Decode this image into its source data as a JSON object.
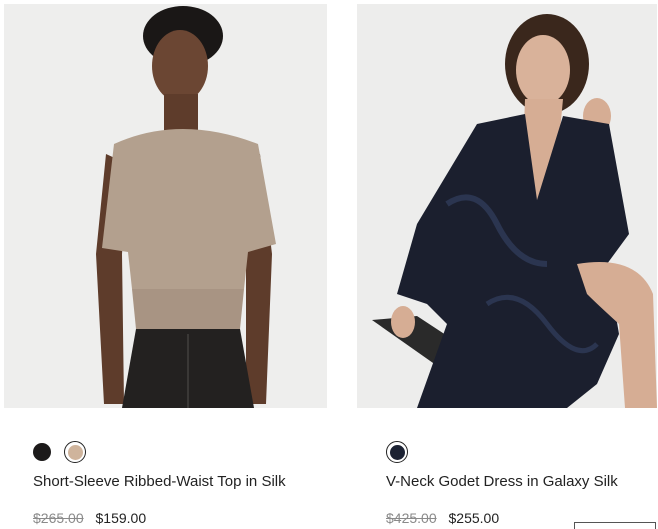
{
  "products": [
    {
      "name": "Short-Sleeve Ribbed-Waist Top in Silk",
      "price_original": "$265.00",
      "price_sale": "$159.00",
      "swatches": [
        {
          "color": "#1c1a1a",
          "selected": false
        },
        {
          "color": "#cfb49c",
          "selected": true
        }
      ]
    },
    {
      "name": "V-Neck Godet Dress in Galaxy Silk",
      "price_original": "$425.00",
      "price_sale": "$255.00",
      "swatches": [
        {
          "color": "#1c2233",
          "selected": true
        }
      ]
    }
  ]
}
